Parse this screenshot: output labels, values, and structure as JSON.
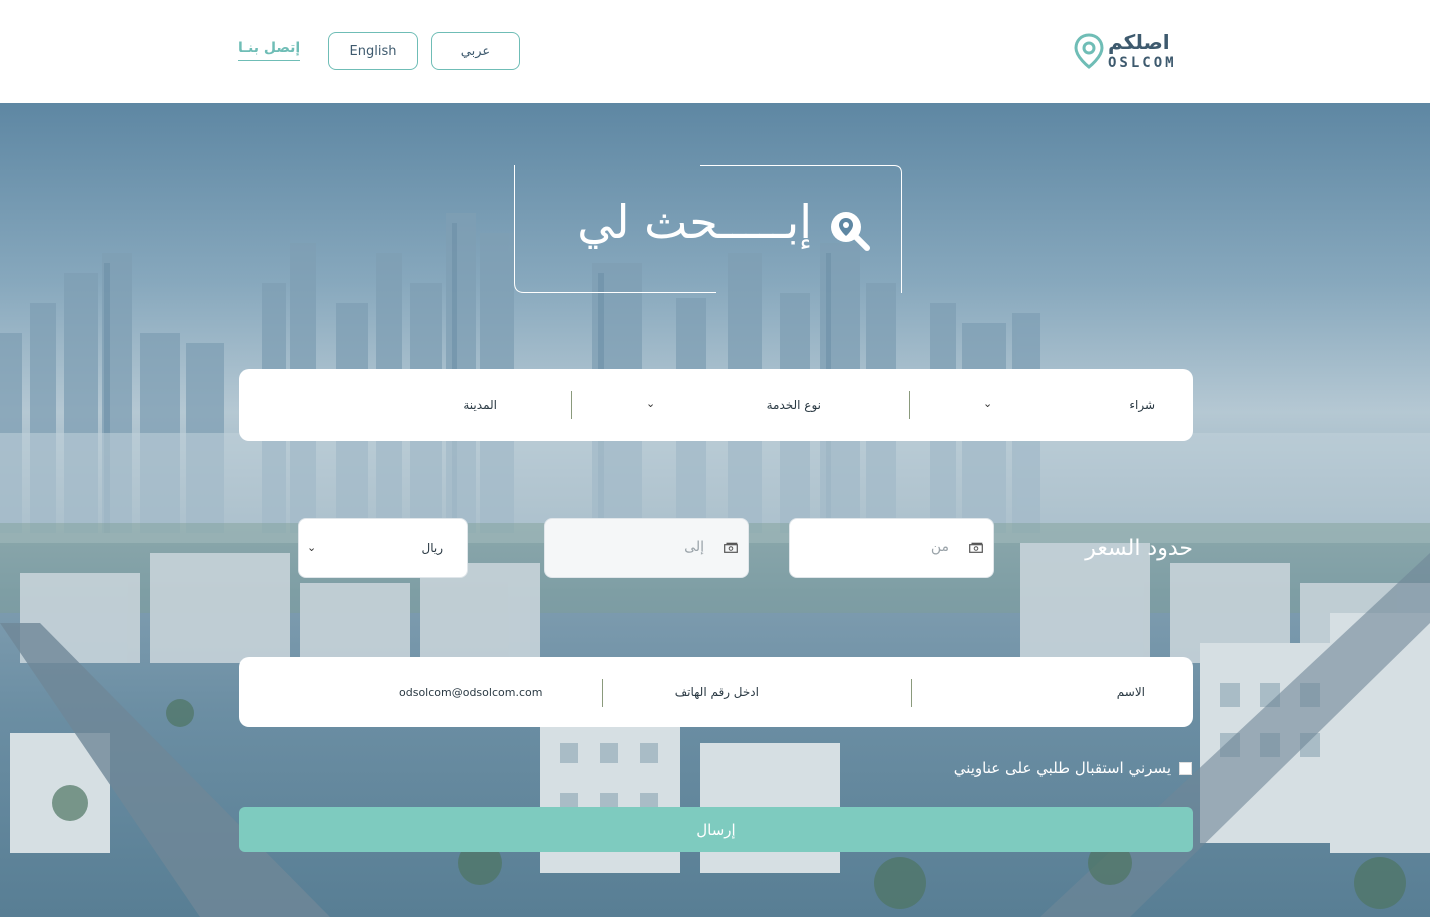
{
  "brand": {
    "name_ar": "اصلكم",
    "name_en": "OSLCOM"
  },
  "header": {
    "lang_ar_label": "عربي",
    "lang_en_label": "English",
    "contact_label": "إتصل بنـا"
  },
  "hero": {
    "title": "إبـــــحث لي"
  },
  "search_bar": {
    "purchase_value": "شراء",
    "service_type_value": "نوع الخدمة",
    "city_placeholder": "المدينة"
  },
  "price": {
    "label": "حدود السعر",
    "from_placeholder": "من",
    "to_placeholder": "إلى",
    "currency_value": "ريال"
  },
  "contact_bar": {
    "name_placeholder": "الاسم",
    "phone_placeholder": "ادخل رقم الهاتف",
    "email_placeholder": "odsolcom@odsolcom.com"
  },
  "agree_label": "يسرني استقبال طلبي على عناويني",
  "submit_label": "إرسال",
  "colors": {
    "accent": "#6fbdb6",
    "submit": "#7ecbbf",
    "brand_text": "#3e5a6e"
  }
}
